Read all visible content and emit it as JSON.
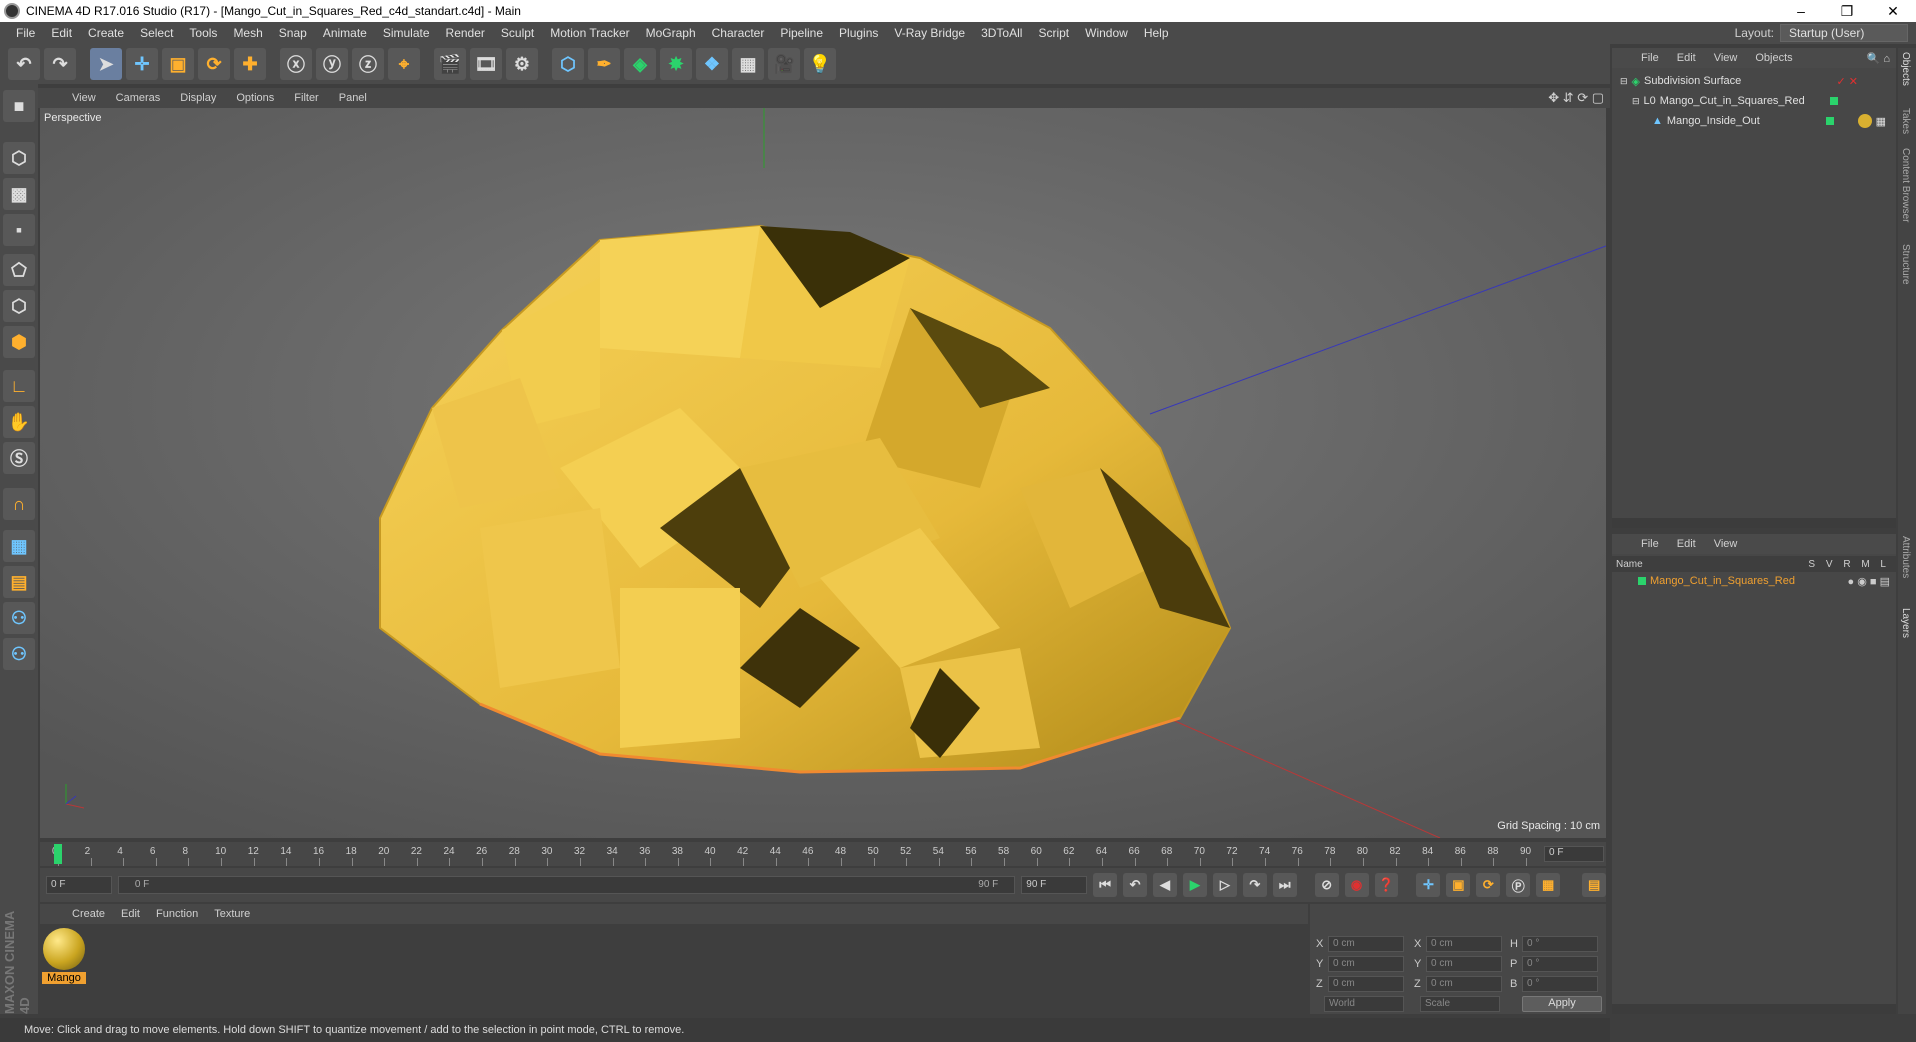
{
  "window": {
    "title": "CINEMA 4D R17.016 Studio (R17) - [Mango_Cut_in_Squares_Red_c4d_standart.c4d] - Main"
  },
  "menu": [
    "File",
    "Edit",
    "Create",
    "Select",
    "Tools",
    "Mesh",
    "Snap",
    "Animate",
    "Simulate",
    "Render",
    "Sculpt",
    "Motion Tracker",
    "MoGraph",
    "Character",
    "Pipeline",
    "Plugins",
    "V-Ray Bridge",
    "3DToAll",
    "Script",
    "Window",
    "Help"
  ],
  "layout": {
    "label": "Layout:",
    "value": "Startup (User)"
  },
  "viewport_menu": [
    "View",
    "Cameras",
    "Display",
    "Options",
    "Filter",
    "Panel"
  ],
  "viewport": {
    "label": "Perspective",
    "grid_spacing": "Grid Spacing : 10 cm"
  },
  "timeline": {
    "ticks": [
      "0",
      "2",
      "4",
      "6",
      "8",
      "10",
      "12",
      "14",
      "16",
      "18",
      "20",
      "22",
      "24",
      "26",
      "28",
      "30",
      "32",
      "34",
      "36",
      "38",
      "40",
      "42",
      "44",
      "46",
      "48",
      "50",
      "52",
      "54",
      "56",
      "58",
      "60",
      "62",
      "64",
      "66",
      "68",
      "70",
      "72",
      "74",
      "76",
      "78",
      "80",
      "82",
      "84",
      "86",
      "88",
      "90"
    ],
    "current_frame": "0 F",
    "start_field": "0 F",
    "range_start": "0 F",
    "range_end": "90 F",
    "end_field": "90 F"
  },
  "material_menu": [
    "Create",
    "Edit",
    "Function",
    "Texture"
  ],
  "material": {
    "name": "Mango"
  },
  "coords": {
    "rows": [
      {
        "a": "X",
        "av": "0 cm",
        "b": "X",
        "bv": "0 cm",
        "c": "H",
        "cv": "0 °"
      },
      {
        "a": "Y",
        "av": "0 cm",
        "b": "Y",
        "bv": "0 cm",
        "c": "P",
        "cv": "0 °"
      },
      {
        "a": "Z",
        "av": "0 cm",
        "b": "Z",
        "bv": "0 cm",
        "c": "B",
        "cv": "0 °"
      }
    ],
    "mode": "World",
    "scale": "Scale",
    "apply": "Apply"
  },
  "status": "Move: Click and drag to move elements. Hold down SHIFT to quantize movement / add to the selection in point mode, CTRL to remove.",
  "object_manager": {
    "menu": [
      "File",
      "Edit",
      "View",
      "Objects"
    ],
    "objects": [
      "Subdivision Surface",
      "Mango_Cut_in_Squares_Red",
      "Mango_Inside_Out"
    ]
  },
  "layer_manager": {
    "menu": [
      "File",
      "Edit",
      "View"
    ],
    "header": {
      "name": "Name",
      "flags": "S V R M L"
    },
    "layers": [
      "Mango_Cut_in_Squares_Red"
    ]
  },
  "right_tabs": [
    "Objects",
    "Takes",
    "Content Browser",
    "Structure",
    "Attributes",
    "Layers"
  ],
  "brand": "MAXON CINEMA 4D",
  "colors": {
    "accent": "#f0a030",
    "layer_green": "#2bd36c"
  }
}
